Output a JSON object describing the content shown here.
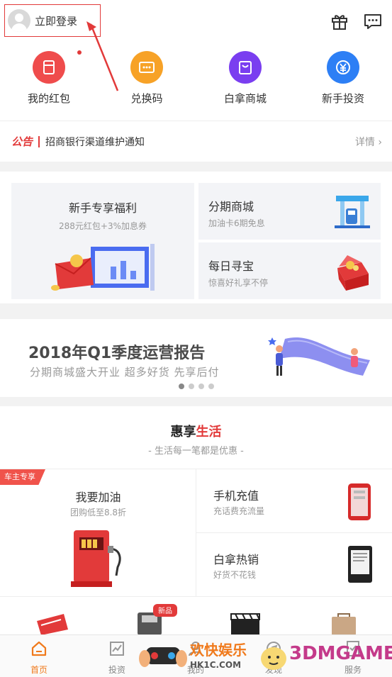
{
  "header": {
    "login_label": "立即登录"
  },
  "quick_entries": [
    {
      "label": "我的红包",
      "icon": "red-packet-icon",
      "color": "#ef4c4c"
    },
    {
      "label": "兑换码",
      "icon": "code-icon",
      "color": "#f7a227"
    },
    {
      "label": "白拿商城",
      "icon": "shopping-bag-icon",
      "color": "#7a3ef0"
    },
    {
      "label": "新手投资",
      "icon": "yuan-icon",
      "color": "#2d7ff5"
    }
  ],
  "notice": {
    "tag": "公告",
    "text": "招商银行渠道维护通知",
    "more": "详情 ›"
  },
  "promo": {
    "newbie": {
      "title": "新手专享福利",
      "subtitle": "288元红包+3%加息券"
    },
    "installment": {
      "title": "分期商城",
      "subtitle": "加油卡6期免息"
    },
    "treasure": {
      "title": "每日寻宝",
      "subtitle": "惊喜好礼享不停"
    }
  },
  "banner": {
    "title": "2018年Q1季度运营报告",
    "subtitle": "分期商城盛大开业 超多好货 先享后付",
    "pages": 4,
    "active_page": 1
  },
  "life": {
    "title_prefix": "惠享",
    "title_highlight": "生活",
    "subtitle": "- 生活每一笔都是优惠 -",
    "fuel": {
      "badge": "车主专享",
      "title": "我要加油",
      "subtitle": "团购低至8.8折"
    },
    "phone": {
      "title": "手机充值",
      "subtitle": "充话费充流量"
    },
    "hot": {
      "title": "白拿热销",
      "subtitle": "好货不花钱"
    },
    "new_badge": "新品"
  },
  "tabs": [
    {
      "label": "首页",
      "active": true
    },
    {
      "label": "投资",
      "active": false
    },
    {
      "label": "我的",
      "active": false
    },
    {
      "label": "发现",
      "active": false
    },
    {
      "label": "服务",
      "active": false
    }
  ],
  "watermark": {
    "brand": "欢快娱乐",
    "domain": "HK1C.COM",
    "site": "3DMGAME"
  },
  "colors": {
    "accent": "#e23a3a",
    "tab_active": "#f07a1c"
  }
}
